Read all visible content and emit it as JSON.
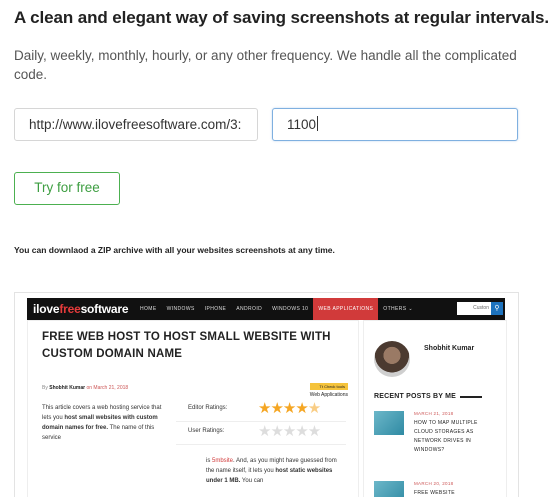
{
  "hero": {
    "headline": "A clean and elegant way of saving screenshots at regular intervals.",
    "subline": "Daily, weekly, monthly, hourly, or any other frequency. We handle all the complicated code."
  },
  "form": {
    "url_value": "http://www.ilovefreesoftware.com/3:",
    "interval_value": "1100",
    "try_label": "Try for free"
  },
  "note": "You can downlaod a ZIP archive with all your websites screenshots at any time.",
  "preview": {
    "logo_pre": "ilove",
    "logo_free": "free",
    "logo_post": "software",
    "nav": [
      "HOME",
      "WINDOWS",
      "IPHONE",
      "ANDROID",
      "WINDOWS 10",
      "WEB APPLICATIONS",
      "OTHERS ⌄"
    ],
    "search_text": "Custon",
    "article": {
      "title": "FREE WEB HOST TO HOST SMALL WEBSITE WITH CUSTOM DOMAIN NAME",
      "by": "By",
      "author": "Shobhit Kumar",
      "date": "on March 21, 2018",
      "category_badge": "Tt Check tools",
      "category": "Web Applications",
      "intro_1": "This article covers a web hosting service that lets you ",
      "intro_bold_1": "host small websites with custom domain names for free.",
      "intro_2": " The name of this service",
      "ratings": [
        {
          "label": "Editor Ratings:",
          "stars": 4.5
        },
        {
          "label": "User Ratings:",
          "stars": 0
        }
      ],
      "body_1": "is ",
      "body_link": "5mbsite",
      "body_2": ". And, as you might have guessed from the name itself, it lets you ",
      "body_bold": "host static websites under 1 MB.",
      "body_3": " You can"
    },
    "sidebar": {
      "author": "Shobhit Kumar",
      "recent_title": "RECENT POSTS BY ME",
      "posts": [
        {
          "date": "MARCH 21, 2018",
          "title": "HOW TO MAP MULTIPLE CLOUD STORAGES AS NETWORK DRIVES IN WINDOWS?"
        },
        {
          "date": "MARCH 20, 2018",
          "title": "FREE WEBSITE"
        }
      ]
    }
  },
  "colors": {
    "accent_green": "#4cb050",
    "brand_red": "#d13a3a",
    "focus_blue": "#7fb0e0"
  }
}
